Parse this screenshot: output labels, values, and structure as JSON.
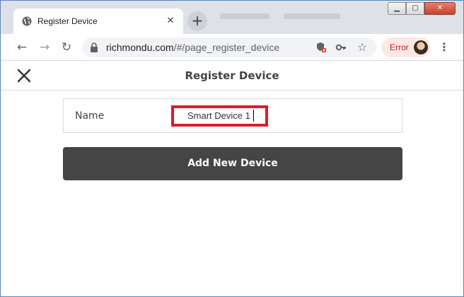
{
  "browser": {
    "tab": {
      "title": "Register Device",
      "favicon": "globe-icon",
      "close_glyph": "✕"
    },
    "new_tab_glyph": "+",
    "window_controls": {
      "minimize": "▁",
      "maximize": "▢",
      "close": "✕"
    },
    "toolbar": {
      "back": "←",
      "forward": "→",
      "reload": "↻",
      "url_host": "richmondu.com",
      "url_path": "/#/page_register_device",
      "star_glyph": "☆",
      "key_glyph": "⚿",
      "shield_glyph": "⛨",
      "profile_status": "Error",
      "menu_glyph": "⋮"
    }
  },
  "app": {
    "title": "Register Device",
    "form": {
      "name_label": "Name",
      "name_value": "Smart Device 1"
    },
    "submit_label": "Add New Device"
  },
  "colors": {
    "highlight_border": "#e01b24",
    "button_bg": "#454545",
    "error_text": "#c5221f",
    "error_bg": "#fce8e6"
  }
}
